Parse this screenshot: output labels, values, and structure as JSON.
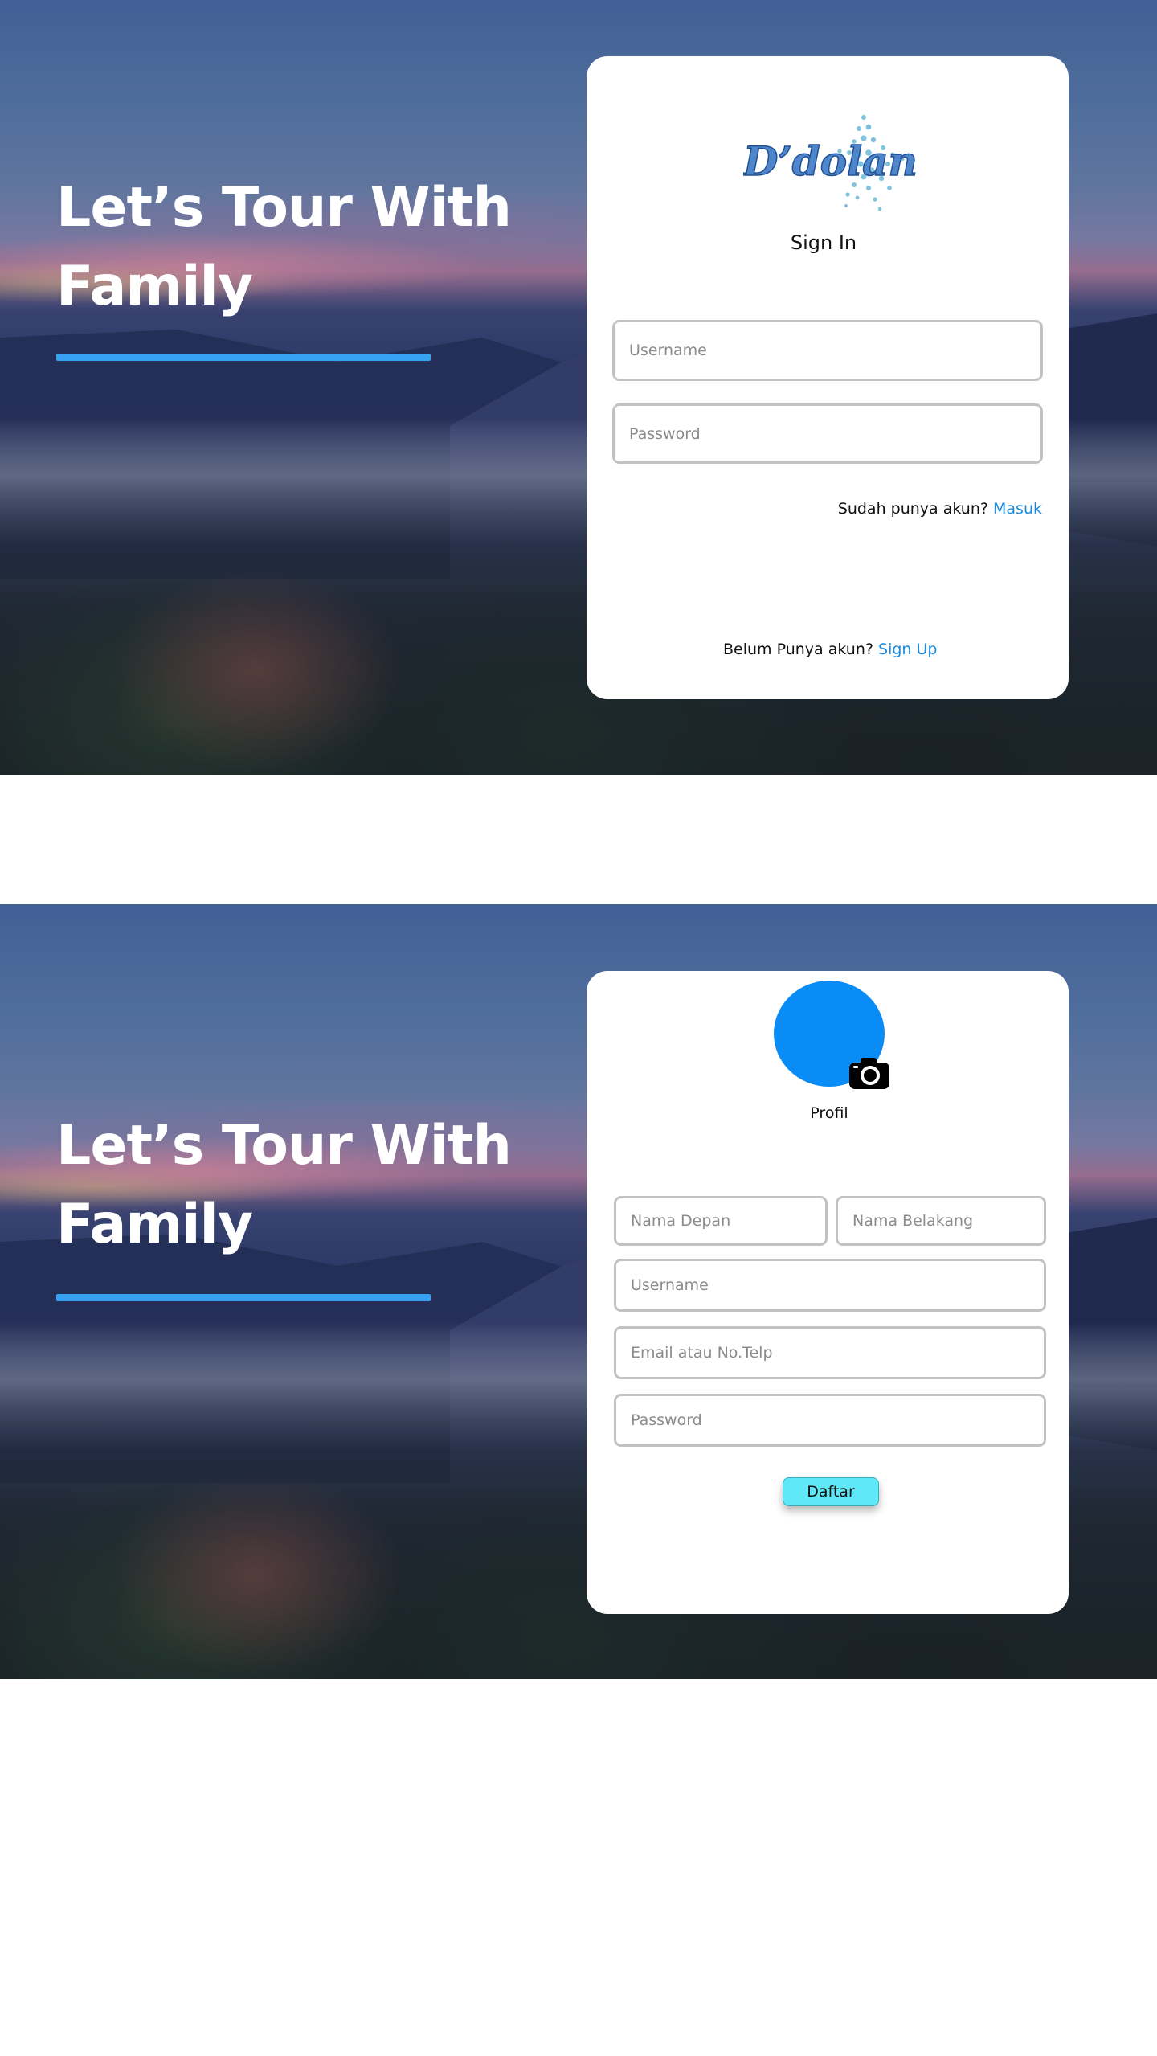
{
  "signin": {
    "headline_line1": "Let’s Tour With",
    "headline_line2": "Family",
    "logo_text": "D’dolan",
    "title": "Sign In",
    "username_placeholder": "Username",
    "password_placeholder": "Password",
    "have_account_text": "Sudah punya akun?",
    "have_account_link": "Masuk",
    "no_account_text": "Belum Punya akun?",
    "no_account_link": "Sign Up"
  },
  "signup": {
    "headline_line1": "Let’s Tour With",
    "headline_line2": "Family",
    "avatar_label": "Profil",
    "first_name_placeholder": "Nama Depan",
    "last_name_placeholder": "Nama Belakang",
    "username_placeholder": "Username",
    "email_placeholder": "Email atau No.Telp",
    "password_placeholder": "Password",
    "submit_label": "Daftar"
  },
  "icons": {
    "logo": "dolan-logo-star",
    "camera": "camera-icon"
  },
  "colors": {
    "accent_underline": "#38a2f2",
    "link": "#1a8ce0",
    "avatar": "#0a8cf7",
    "button": "#5fe8f7"
  }
}
